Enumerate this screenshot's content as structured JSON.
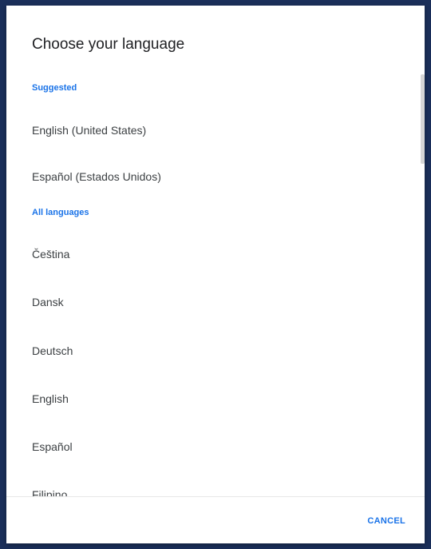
{
  "dialog": {
    "title": "Choose your language",
    "suggested_header": "Suggested",
    "suggested_items": [
      "English (United States)",
      "Español (Estados Unidos)"
    ],
    "all_header": "All languages",
    "all_items": [
      "Čeština",
      "Dansk",
      "Deutsch",
      "English",
      "Español",
      "Filipino"
    ],
    "cancel_label": "CANCEL"
  },
  "colors": {
    "accent": "#1a73e8",
    "backdrop": "#1b2f5a"
  }
}
